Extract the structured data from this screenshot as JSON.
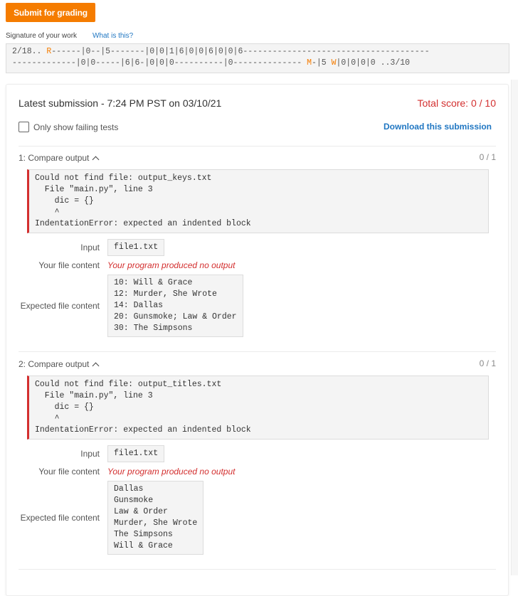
{
  "toolbar": {
    "submit_label": "Submit for grading"
  },
  "signature": {
    "label": "Signature of your work",
    "help_link": "What is this?",
    "line1_prefix": "2/18.. ",
    "line1_mark": "R",
    "line1_rest": "------|0--|5-------|0|0|1|6|0|0|6|0|0|6--------------------------------------",
    "line2_a": "-------------|0|0-----|6|6-|0|0|0----------|0-------------- ",
    "line2_mark_m": "M",
    "line2_b": "-|5 ",
    "line2_mark_w": "W",
    "line2_c": "|0|0|0|0 ..3/10"
  },
  "submission": {
    "title": "Latest submission - 7:24 PM PST on 03/10/21",
    "total_score": "Total score: 0 / 10",
    "filter_label": "Only show failing tests",
    "filter_checked": false,
    "download_label": "Download this submission"
  },
  "tests": [
    {
      "title": "1: Compare output",
      "score": "0 / 1",
      "error": "Could not find file: output_keys.txt\n  File \"main.py\", line 3\n    dic = {}\n    ^\nIndentationError: expected an indented block",
      "input_label": "Input",
      "input_value": "file1.txt",
      "your_label": "Your file content",
      "your_value": "Your program produced no output",
      "expected_label": "Expected file content",
      "expected_value": "10: Will & Grace\n12: Murder, She Wrote\n14: Dallas\n20: Gunsmoke; Law & Order\n30: The Simpsons"
    },
    {
      "title": "2: Compare output",
      "score": "0 / 1",
      "error": "Could not find file: output_titles.txt\n  File \"main.py\", line 3\n    dic = {}\n    ^\nIndentationError: expected an indented block",
      "input_label": "Input",
      "input_value": "file1.txt",
      "your_label": "Your file content",
      "your_value": "Your program produced no output",
      "expected_label": "Expected file content",
      "expected_value": "Dallas\nGunsmoke\nLaw & Order\nMurder, She Wrote\nThe Simpsons\nWill & Grace"
    }
  ],
  "colors": {
    "accent": "#f57c00",
    "error": "#d32f2f",
    "link": "#1f76c2"
  }
}
